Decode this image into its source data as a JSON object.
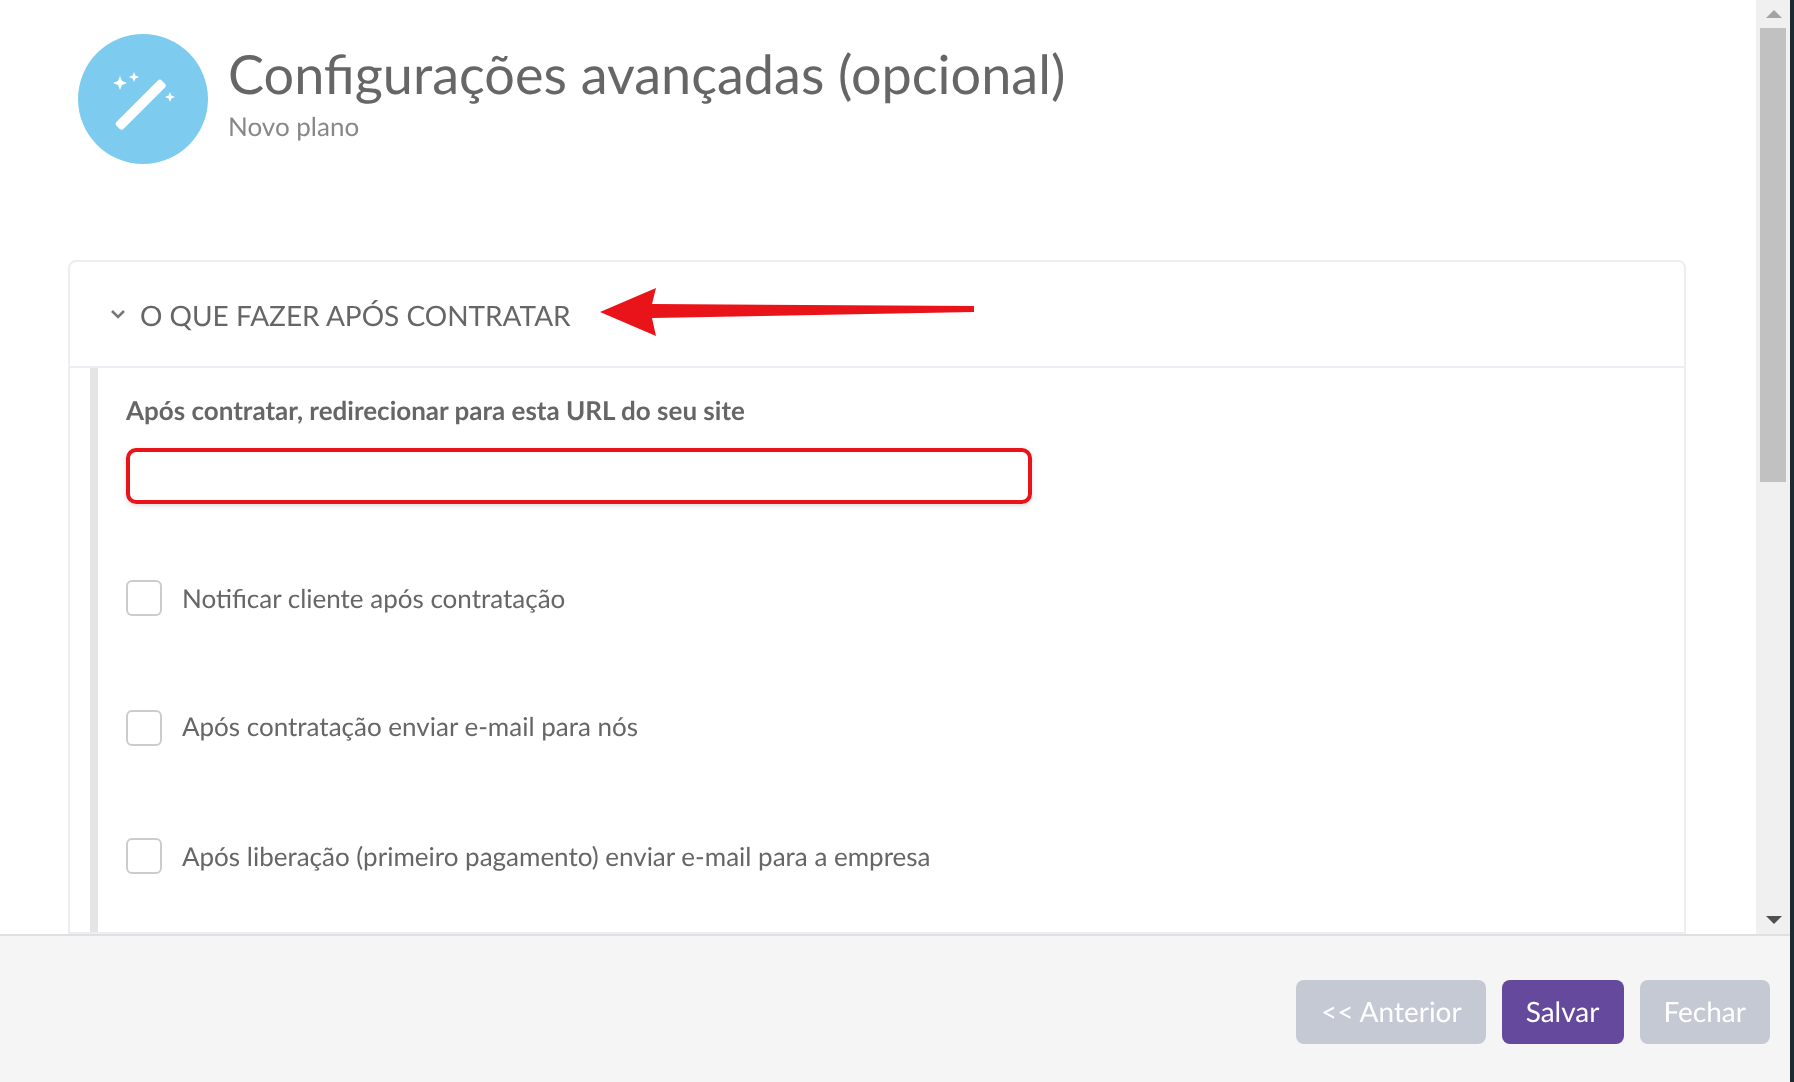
{
  "header": {
    "title": "Configurações avançadas (opcional)",
    "subtitle": "Novo plano"
  },
  "section": {
    "title": "O QUE FAZER APÓS CONTRATAR",
    "expanded": true,
    "annotated": true,
    "url_field": {
      "label": "Após contratar, redirecionar para esta URL do seu site",
      "highlighted": true
    },
    "options": [
      {
        "label": "Notificar cliente após contratação",
        "checked": false
      },
      {
        "label": "Após contratação enviar e-mail para nós",
        "checked": false
      },
      {
        "label": "Após liberação (primeiro pagamento) enviar e-mail para a empresa",
        "checked": false
      }
    ]
  },
  "buttons": [
    {
      "label": "<< Anterior",
      "kind": "secondary",
      "disabled": true
    },
    {
      "label": "Salvar",
      "kind": "primary",
      "disabled": false
    },
    {
      "label": "Fechar",
      "kind": "secondary",
      "disabled": true
    }
  ]
}
